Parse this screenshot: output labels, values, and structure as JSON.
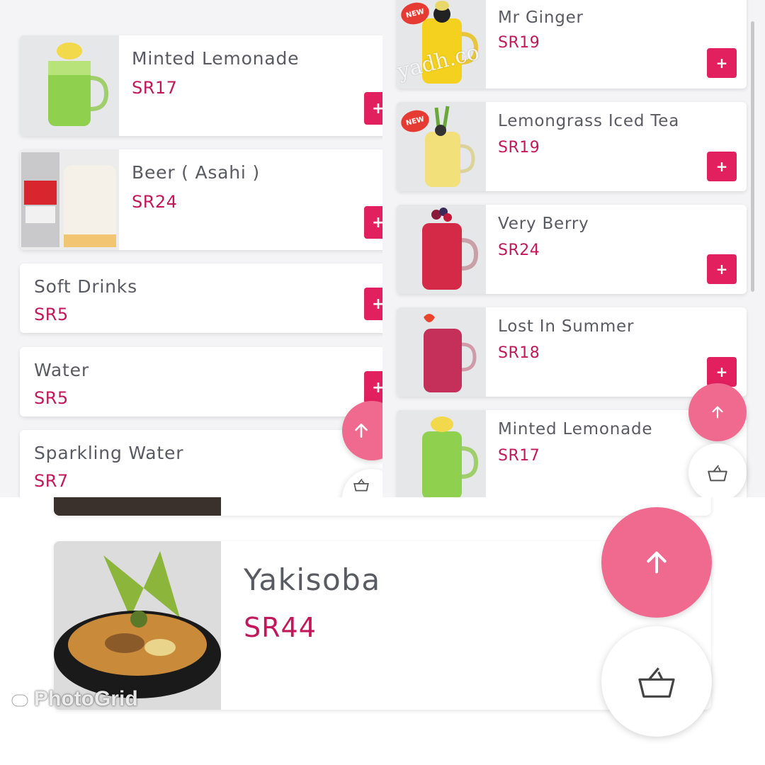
{
  "left_panel": {
    "items": [
      {
        "name": "Minted Lemonade",
        "price": "SR17",
        "image": "green-lemonade-jar"
      },
      {
        "name": "Beer ( Asahi )",
        "price": "SR24",
        "image": "asahi-can-and-glass"
      },
      {
        "name": "Soft Drinks",
        "price": "SR5"
      },
      {
        "name": "Water",
        "price": "SR5"
      },
      {
        "name": "Sparkling Water",
        "price": "SR7"
      }
    ]
  },
  "right_panel": {
    "items": [
      {
        "name": "Mr Ginger",
        "price": "SR19",
        "badge": "NEW",
        "image": "yellow-ginger-jar"
      },
      {
        "name": "Lemongrass Iced Tea",
        "price": "SR19",
        "badge": "NEW",
        "image": "lemongrass-tea-jar"
      },
      {
        "name": "Very Berry",
        "price": "SR24",
        "image": "red-berry-jar"
      },
      {
        "name": "Lost In Summer",
        "price": "SR18",
        "image": "pink-strawberry-jar"
      },
      {
        "name": "Minted Lemonade",
        "price": "SR17",
        "image": "green-lemonade-jar"
      }
    ],
    "watermark": "yadh.co"
  },
  "bottom_panel": {
    "item": {
      "name": "Yakisoba",
      "price": "SR44",
      "image": "yakisoba-noodle-bowl"
    }
  },
  "buttons": {
    "add_label": "+",
    "scroll_top_icon": "arrow-up-icon",
    "basket_icon": "basket-icon"
  },
  "branding": {
    "logo_text": "PhotoGrid"
  },
  "colors": {
    "accent": "#e21f5f",
    "price": "#c2185b",
    "fab": "#f06a90",
    "text": "#5a5a62"
  }
}
